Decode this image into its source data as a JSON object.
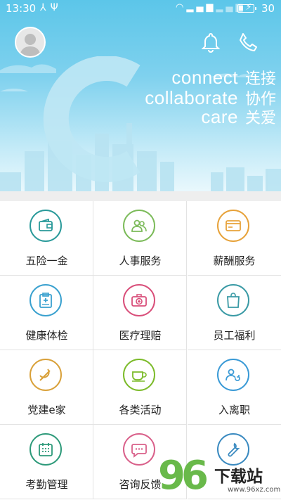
{
  "status_bar": {
    "time": "13:30",
    "battery": "30",
    "battery_level": 0.3
  },
  "header": {
    "tagline": [
      {
        "en": "connect",
        "zh": "连接"
      },
      {
        "en": "collaborate",
        "zh": "协作"
      },
      {
        "en": "care",
        "zh": "关爱"
      }
    ],
    "letter": "C"
  },
  "grid": {
    "items": [
      {
        "label": "五险一金",
        "icon": "wallet-icon",
        "color": "#2a9a9a"
      },
      {
        "label": "人事服务",
        "icon": "users-icon",
        "color": "#7cbb5a"
      },
      {
        "label": "薪酬服务",
        "icon": "card-icon",
        "color": "#e7a23a"
      },
      {
        "label": "健康体检",
        "icon": "clipboard-medical-icon",
        "color": "#3aa1cf"
      },
      {
        "label": "医疗理赔",
        "icon": "medical-kit-icon",
        "color": "#d94f7a"
      },
      {
        "label": "员工福利",
        "icon": "gift-bag-icon",
        "color": "#3a9aa5"
      },
      {
        "label": "党建e家",
        "icon": "party-emblem-icon",
        "color": "#d9a13a"
      },
      {
        "label": "各类活动",
        "icon": "coffee-cup-icon",
        "color": "#7cbb2a"
      },
      {
        "label": "入离职",
        "icon": "person-swap-icon",
        "color": "#3a9ad6"
      },
      {
        "label": "考勤管理",
        "icon": "calendar-icon",
        "color": "#2e9a7a"
      },
      {
        "label": "咨询反馈",
        "icon": "chat-bubble-icon",
        "color": "#d9608a"
      },
      {
        "label": "",
        "icon": "wrench-icon",
        "color": "#3a8ac0"
      }
    ]
  },
  "watermark": {
    "number": "96",
    "text": "下载站",
    "url": "www.96xz.com"
  }
}
